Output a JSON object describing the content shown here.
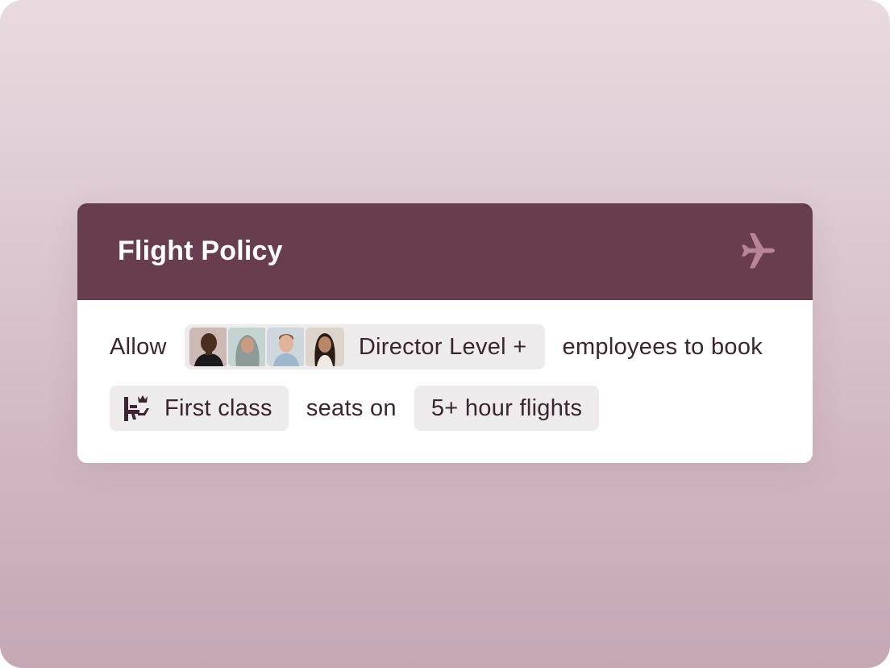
{
  "policy": {
    "title": "Flight Policy",
    "header_icon": "airplane-icon",
    "sentence": {
      "allow": "Allow",
      "employee_group": {
        "label": "Director Level +",
        "avatars": [
          "employee-avatar-1",
          "employee-avatar-2",
          "employee-avatar-3",
          "employee-avatar-4"
        ]
      },
      "employees_to_book": "employees to book",
      "seat_class": {
        "icon": "first-class-seat-icon",
        "label": "First class"
      },
      "seats_on": "seats on",
      "flight_duration": "5+ hour flights"
    }
  },
  "colors": {
    "header_bg": "#683d50",
    "chip_bg": "#eeebec",
    "text": "#3b2530",
    "icon_muted": "#b9849a"
  }
}
